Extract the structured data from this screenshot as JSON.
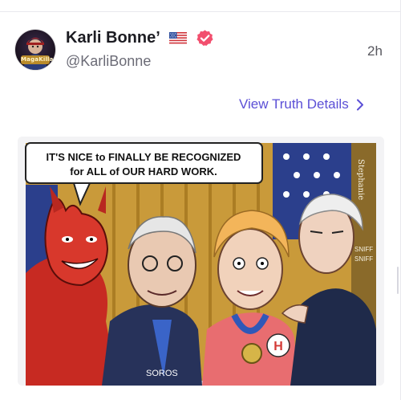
{
  "post": {
    "author": {
      "display_name": "Karli Bonne’",
      "handle": "@KarliBonne",
      "avatar_text": "MagaKilla",
      "flag_icon": "us-flag-icon",
      "verified_icon": "verified-badge-icon",
      "verified_color": "#f24f6e"
    },
    "time": "2h",
    "details_link": {
      "label": "View Truth Details",
      "icon": "chevron-right-icon",
      "color": "#5b4fd6"
    },
    "media": {
      "type": "cartoon image",
      "speech_bubble": {
        "line1": "IT'S NICE to FINALLY BE RECOGNIZED",
        "line2": "for ALL of OUR HARD WORK."
      },
      "caption_label": "SOROS",
      "signature": "Stephanie",
      "side_text_line1": "SNIFF",
      "side_text_line2": "SNIFF",
      "button_letter": "H"
    }
  }
}
